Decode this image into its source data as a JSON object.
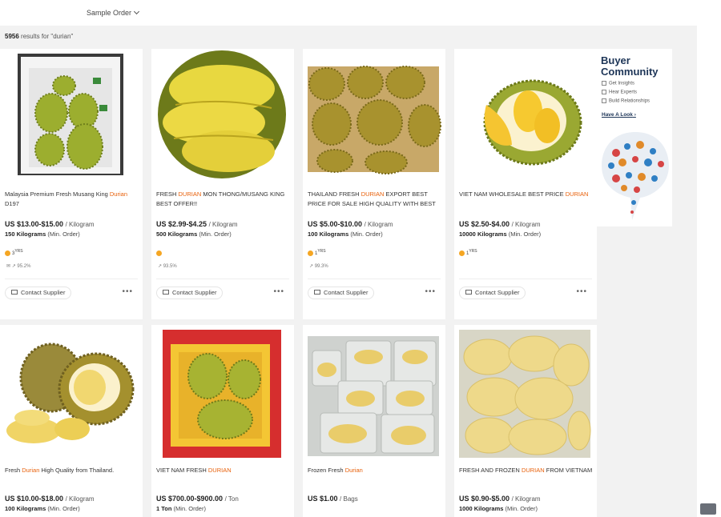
{
  "header": {
    "sort_label": "Sample Order"
  },
  "results": {
    "count": "5956",
    "suffix": "results for \"durian\""
  },
  "cards": [
    {
      "title_pre": "Malaysia Premium Fresh Musang King ",
      "title_hl": "Durian",
      "title_post": " D197",
      "price": "US $13.00-$15.00",
      "unit": "/ Kilogram",
      "moq_qty": "150 Kilograms",
      "moq_label": "(Min. Order)",
      "years": "3",
      "years_suffix": "YRS",
      "rate": "95.2%",
      "contact": "Contact Supplier"
    },
    {
      "title_pre": "FRESH ",
      "title_hl": "DURIAN",
      "title_post": " MON THONG/MUSANG KING BEST OFFER!!",
      "price": "US $2.99-$4.25",
      "unit": "/ Kilogram",
      "moq_qty": "500 Kilograms",
      "moq_label": "(Min. Order)",
      "years": "",
      "years_suffix": "",
      "rate": "93.5%",
      "contact": "Contact Supplier"
    },
    {
      "title_pre": "THAILAND FRESH ",
      "title_hl": "DURIAN",
      "title_post": " EXPORT BEST PRICE FOR SALE HIGH QUALITY WITH BEST",
      "price": "US $5.00-$10.00",
      "unit": "/ Kilogram",
      "moq_qty": "100 Kilograms",
      "moq_label": "(Min. Order)",
      "years": "1",
      "years_suffix": "YRS",
      "rate": "99.3%",
      "contact": "Contact Supplier"
    },
    {
      "title_pre": "VIET NAM WHOLESALE BEST PRICE ",
      "title_hl": "DURIAN",
      "title_post": "",
      "price": "US $2.50-$4.00",
      "unit": "/ Kilogram",
      "moq_qty": "10000 Kilograms",
      "moq_label": "(Min. Order)",
      "years": "1",
      "years_suffix": "YRS",
      "rate": "",
      "contact": "Contact Supplier"
    },
    {
      "title_pre": "Fresh ",
      "title_hl": "Durian",
      "title_post": " High Quality from Thailand.",
      "price": "US $10.00-$18.00",
      "unit": "/ Kilogram",
      "moq_qty": "100 Kilograms",
      "moq_label": "(Min. Order)"
    },
    {
      "title_pre": "VIET NAM FRESH ",
      "title_hl": "DURIAN",
      "title_post": "",
      "price": "US $700.00-$900.00",
      "unit": "/ Ton",
      "moq_qty": "1 Ton",
      "moq_label": "(Min. Order)"
    },
    {
      "title_pre": "Frozen Fresh ",
      "title_hl": "Durian",
      "title_post": "",
      "price": "US $1.00",
      "unit": "/ Bags",
      "moq_qty": "",
      "moq_label": ""
    },
    {
      "title_pre": "FRESH AND FROZEN ",
      "title_hl": "DURIAN",
      "title_post": " FROM VIETNAM",
      "price": "US $0.90-$5.00",
      "unit": "/ Kilogram",
      "moq_qty": "1000 Kilograms",
      "moq_label": "(Min. Order)"
    }
  ],
  "ad": {
    "title": "Buyer Community",
    "items": [
      "Get Insights",
      "Hear Experts",
      "Build Relationships"
    ],
    "link": "Have A Look"
  },
  "colors": {
    "highlight": "#e8600a",
    "durian_green": "#8a9a2c",
    "durian_flesh": "#f2d24a"
  }
}
